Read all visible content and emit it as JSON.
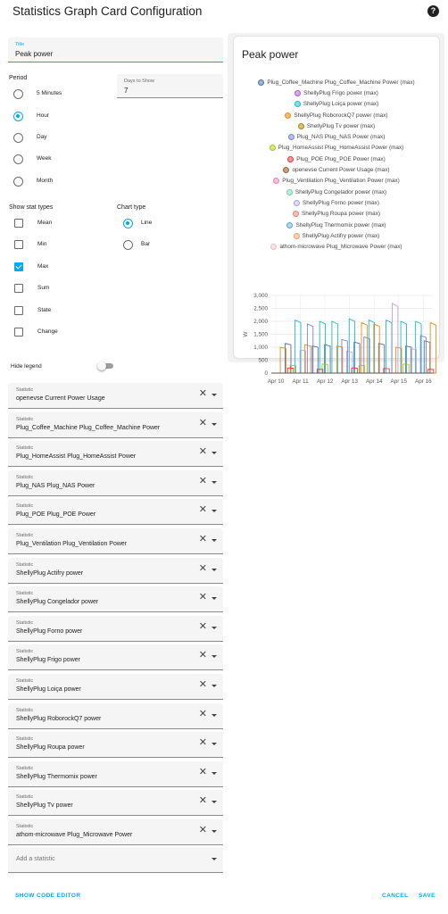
{
  "dialog": {
    "title": "Statistics Graph Card Configuration"
  },
  "form": {
    "title_field": {
      "label": "Title",
      "value": "Peak power"
    },
    "period": {
      "label": "Period",
      "options": [
        "5 Minutes",
        "Hour",
        "Day",
        "Week",
        "Month"
      ],
      "selected": "Hour"
    },
    "days_to_show": {
      "label": "Days to Show",
      "value": "7"
    },
    "stat_types": {
      "label": "Show stat types",
      "options": [
        "Mean",
        "Min",
        "Max",
        "Sum",
        "State",
        "Change"
      ],
      "checked": [
        "Max"
      ]
    },
    "chart_type": {
      "label": "Chart type",
      "options": [
        "Line",
        "Bar"
      ],
      "selected": "Line"
    },
    "hide_legend": {
      "label": "Hide legend",
      "on": false
    },
    "statistic_label": "Statistic",
    "statistics": [
      "openevse Current Power Usage",
      "Plug_Coffee_Machine Plug_Coffee_Machine Power",
      "Plug_HomeAssist Plug_HomeAssist Power",
      "Plug_NAS Plug_NAS Power",
      "Plug_POE Plug_POE Power",
      "Plug_Ventilation Plug_Ventilation Power",
      "ShellyPlug Actifry power",
      "ShellyPlug Congelador  power",
      "ShellyPlug Forno power",
      "ShellyPlug Frigo power",
      "ShellyPlug Loiça power",
      "ShellyPlug RoborockQ7 power",
      "ShellyPlug Roupa power",
      "ShellyPlug Thermomix power",
      "ShellyPlug Tv power",
      "athom-microwave Plug_Microwave Power"
    ],
    "add_statistic_placeholder": "Add a statistic"
  },
  "footer": {
    "code_editor": "SHOW CODE EDITOR",
    "cancel": "CANCEL",
    "save": "SAVE"
  },
  "preview": {
    "title": "Peak power",
    "legend": [
      {
        "label": "Plug_Coffee_Machine Plug_Coffee_Machine Power (max)",
        "color": "#4f6fa8",
        "fill": "#9fb3d6"
      },
      {
        "label": "ShellyPlug Frigo power (max)",
        "color": "#b05fc4",
        "fill": "#dca6e8"
      },
      {
        "label": "ShellyPlug Loiça power (max)",
        "color": "#1fb8c4",
        "fill": "#7fe2ea"
      },
      {
        "label": "ShellyPlug RoborockQ7 power (max)",
        "color": "#f08a1c",
        "fill": "#f9bd7a"
      },
      {
        "label": "ShellyPlug Tv power (max)",
        "color": "#a2891a",
        "fill": "#d9c56a"
      },
      {
        "label": "Plug_NAS Plug_NAS Power (max)",
        "color": "#7986cb",
        "fill": "#b7bfe6"
      },
      {
        "label": "Plug_HomeAssist Plug_HomeAssist Power (max)",
        "color": "#a9c41b",
        "fill": "#d8ea7e"
      },
      {
        "label": "Plug_POE Plug_POE Power (max)",
        "color": "#e03b3b",
        "fill": "#f29a9a"
      },
      {
        "label": "openevse Current Power Usage (max)",
        "color": "#8e6a3e",
        "fill": "#c6a27a"
      },
      {
        "label": "Plug_Ventilation Plug_Ventilation Power (max)",
        "color": "#e57fb9",
        "fill": "#f5c0de"
      },
      {
        "label": "ShellyPlug Congelador  power (max)",
        "color": "#6fcfae",
        "fill": "#c1ecdc"
      },
      {
        "label": "ShellyPlug Forno power (max)",
        "color": "#9fa8da",
        "fill": "#dadff2"
      },
      {
        "label": "ShellyPlug Roupa power (max)",
        "color": "#f07f73",
        "fill": "#f8bfb8"
      },
      {
        "label": "ShellyPlug Thermomix power (max)",
        "color": "#5ba6d6",
        "fill": "#b0d7ef"
      },
      {
        "label": "ShellyPlug Actifry power (max)",
        "color": "#f4a261",
        "fill": "#f9d1ae"
      },
      {
        "label": "athom-microwave Plug_Microwave Power (max)",
        "color": "#f2b8c6",
        "fill": "#fbe3e9"
      }
    ]
  },
  "chart_data": {
    "type": "line",
    "ylabel": "W",
    "ylim": [
      0,
      3000
    ],
    "yticks": [
      "0",
      "500",
      "1,000",
      "1,500",
      "2,000",
      "2,500",
      "3,000"
    ],
    "xticks": [
      "Apr 10",
      "Apr 11",
      "Apr 12",
      "Apr 13",
      "Apr 14",
      "Apr 15",
      "Apr 16"
    ],
    "grid": true,
    "series": [
      {
        "name": "Plug_Coffee_Machine Plug_Coffee_Machine Power (max)",
        "color": "#4f6fa8",
        "peaks": [
          [
            0.5,
            1150
          ],
          [
            1.6,
            1050
          ],
          [
            2.1,
            1100
          ],
          [
            3.3,
            1200
          ],
          [
            4.3,
            1150
          ],
          [
            5.4,
            1050
          ],
          [
            6.15,
            1250
          ]
        ]
      },
      {
        "name": "ShellyPlug Loiça power (max)",
        "color": "#1fb8c4",
        "peaks": [
          [
            0.9,
            2050
          ],
          [
            1.9,
            2000
          ],
          [
            2.4,
            2000
          ],
          [
            3.1,
            2100
          ],
          [
            3.9,
            2050
          ],
          [
            4.6,
            2050
          ],
          [
            5.2,
            2000
          ],
          [
            5.8,
            2000
          ]
        ]
      },
      {
        "name": "ShellyPlug RoborockQ7 power (max)",
        "color": "#f08a1c",
        "peaks": [
          [
            0.3,
            1000
          ],
          [
            1.3,
            1100
          ],
          [
            2.6,
            1050
          ],
          [
            3.6,
            1950
          ],
          [
            4.1,
            1900
          ],
          [
            5.0,
            1000
          ],
          [
            6.4,
            1950
          ]
        ]
      },
      {
        "name": "athom-microwave Plug_Microwave Power (max)",
        "color": "#c9a2d8",
        "peaks": [
          [
            4.85,
            2700
          ],
          [
            1.1,
            900
          ],
          [
            3.0,
            850
          ],
          [
            5.6,
            950
          ]
        ]
      },
      {
        "name": "Plug_NAS Plug_NAS Power (max)",
        "color": "#7986cb",
        "peaks": [
          [
            1.4,
            1900
          ],
          [
            2.8,
            1300
          ],
          [
            3.7,
            1400
          ],
          [
            6.0,
            1450
          ]
        ]
      },
      {
        "name": "Plug_HomeAssist Plug_HomeAssist Power (max)",
        "color": "#a9c41b",
        "peaks": [
          [
            0.7,
            300
          ],
          [
            2.0,
            350
          ],
          [
            3.5,
            300
          ],
          [
            5.3,
            350
          ]
        ]
      },
      {
        "name": "Plug_POE Plug_POE Power (max)",
        "color": "#e03b3b",
        "peaks": [
          [
            0.6,
            200
          ],
          [
            1.8,
            150
          ],
          [
            3.2,
            200
          ],
          [
            4.5,
            180
          ],
          [
            6.3,
            150
          ]
        ]
      }
    ]
  }
}
